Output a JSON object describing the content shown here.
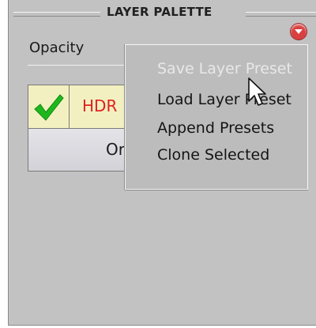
{
  "panel": {
    "title": "LAYER PALETTE",
    "opacity_label": "Opacity",
    "menu_button_icon": "chevron-down-icon"
  },
  "layers": {
    "row1": {
      "checked": true,
      "name": "HDR"
    },
    "row2": {
      "name": "Ori"
    }
  },
  "context_menu": {
    "items": [
      {
        "label": "Save Layer Preset",
        "enabled": false
      },
      {
        "label": "Load Layer Preset",
        "enabled": true
      },
      {
        "label": "Append Presets",
        "enabled": true
      },
      {
        "label": "Clone Selected",
        "enabled": true
      }
    ]
  },
  "colors": {
    "panel_bg": "#c2c2c2",
    "menu_bg": "#bcbcbc",
    "layer_row_highlight": "#f2f0c0",
    "layer_name_red": "#e02020",
    "menu_button_red": "#d94040",
    "check_green": "#1db81d"
  }
}
